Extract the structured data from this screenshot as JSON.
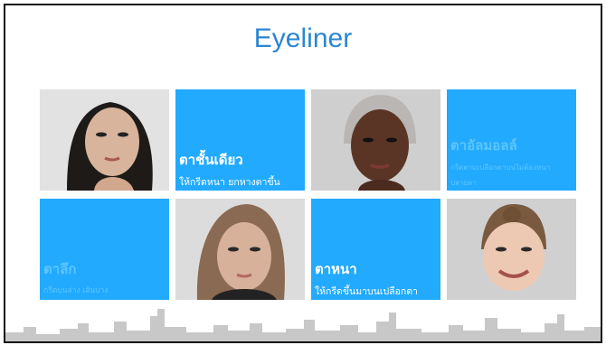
{
  "slide": {
    "title": "Eyeliner",
    "tiles": [
      {
        "id": "photo-1",
        "kind": "photo",
        "alt": "model with light skin and dark hair"
      },
      {
        "id": "single-lid",
        "kind": "text",
        "name": "ตาชั้นเดียว",
        "desc": "ให้กรีดหนา ยกหางตาขึ้น",
        "style": "white"
      },
      {
        "id": "photo-2",
        "kind": "photo",
        "alt": "model with dark skin and slicked hair"
      },
      {
        "id": "almond",
        "kind": "text",
        "name": "ตาอัลมอลล์",
        "desc": "กรีดตามเปลือกตาบนไม่ต้องหนา\nปลายตา",
        "style": "faint"
      },
      {
        "id": "deep-set",
        "kind": "text",
        "name": "ตาลึก",
        "desc": "กรีดบนล่าง เส้นบาง",
        "style": "faint"
      },
      {
        "id": "photo-3",
        "kind": "photo",
        "alt": "model with light brown hair"
      },
      {
        "id": "thick-lid",
        "kind": "text",
        "name": "ตาหนา",
        "desc": "ให้กรีดขึ้นมาบนเปลือกตา",
        "style": "white"
      },
      {
        "id": "photo-4",
        "kind": "photo",
        "alt": "smiling model with pulled back hair"
      }
    ]
  },
  "colors": {
    "title": "#2a86d1",
    "tile_blue": "#22aaff",
    "skyline": "#c8c8c8"
  }
}
